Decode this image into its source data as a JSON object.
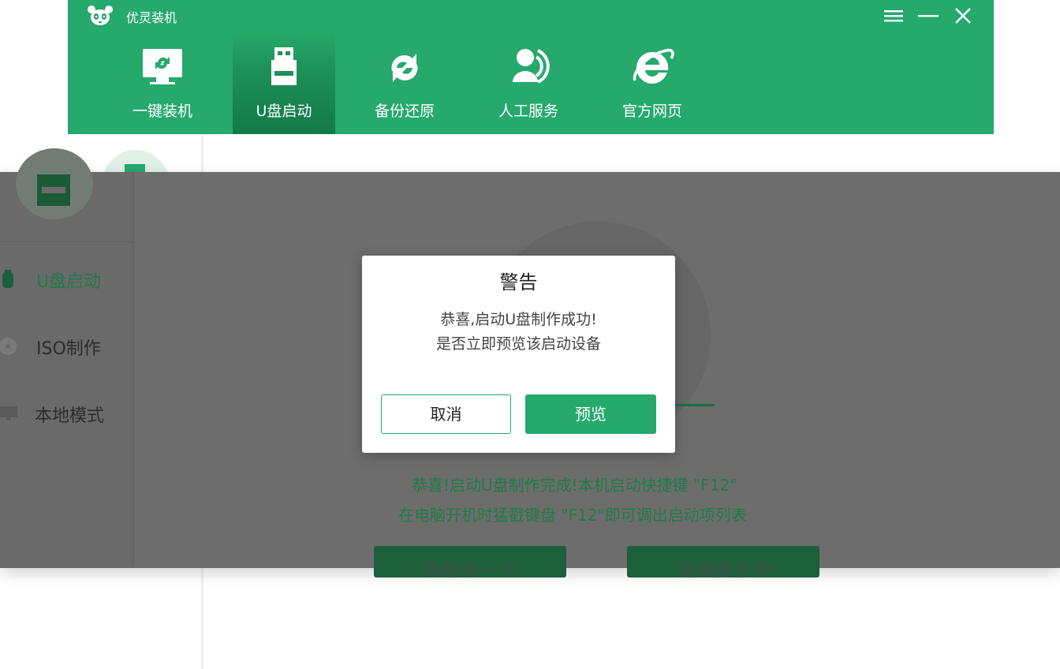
{
  "app": {
    "title": "优灵装机",
    "brand_color": "#26a96c"
  },
  "window_controls": [
    {
      "name": "menu-icon"
    },
    {
      "name": "minimize-icon"
    },
    {
      "name": "close-icon"
    }
  ],
  "nav": {
    "items": [
      {
        "label": "一键装机",
        "icon": "monitor-refresh-icon",
        "active": false
      },
      {
        "label": "U盘启动",
        "icon": "usb-drive-icon",
        "active": true
      },
      {
        "label": "备份还原",
        "icon": "backup-restore-icon",
        "active": false
      },
      {
        "label": "人工服务",
        "icon": "customer-service-icon",
        "active": false
      },
      {
        "label": "官方网页",
        "icon": "ie-browser-icon",
        "active": false
      }
    ]
  },
  "sidebar": {
    "items": [
      {
        "label": "U盘启动",
        "icon": "usb-icon",
        "active": true
      },
      {
        "label": "ISO制作",
        "icon": "disc-icon",
        "active": false
      },
      {
        "label": "本地模式",
        "icon": "monitor-icon",
        "active": false
      }
    ]
  },
  "main": {
    "message_line1": "恭喜!启动U盘制作完成!本机启动快捷键 \"F12\"",
    "message_line2": "在电脑开机时猛戳键盘 \"F12\"即可调出启动项列表",
    "button1_label": "再制作一个",
    "button2_label": "快捷键大全"
  },
  "dialog": {
    "title": "警告",
    "line1": "恭喜,启动U盘制作成功!",
    "line2": "是否立即预览该启动设备",
    "cancel_label": "取消",
    "preview_label": "预览"
  }
}
